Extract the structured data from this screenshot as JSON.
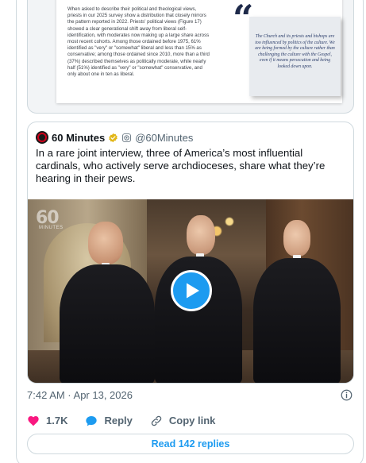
{
  "document_image": {
    "body_text": "When asked to describe their political and theological views, priests in our 2025 survey show a distribution that closely mirrors the pattern reported in 2022. Priests' political views (Figure 17) showed a clear generational shift away from liberal self-identification, with moderates now making up a large share across most recent cohorts. Among those ordained before 1975, 61% identified as \"very\" or \"somewhat\" liberal and less than 15% as conservative; among those ordained since 2010, more than a third (37%) described themselves as politically moderate, while nearly half (51%) identified as \"very\" or \"somewhat\" conservative, and only about one in ten as liberal.",
    "quote_mark": "“",
    "pull_quote": "The Church and its priests and bishops are too influenced by politics of the culture. We are being formed by the culture rather than challenging the culture with the Gospel, even if it means persecution and being looked down upon."
  },
  "quoted_tweet": {
    "author_name": "60 Minutes",
    "handle": "@60Minutes",
    "text": "In a rare joint interview, three of America’s most influential cardinals, who actively serve archdioceses, share what they’re hearing in their pews.",
    "video": {
      "logo_text": "60",
      "logo_subtext": "MINUTES",
      "play_icon": "play-icon"
    }
  },
  "tweet": {
    "timestamp": "7:42 AM · Apr 13, 2026",
    "likes": "1.7K",
    "reply_label": "Reply",
    "copy_link_label": "Copy link",
    "read_replies_label": "Read 142 replies"
  },
  "colors": {
    "accent": "#1d9bf0",
    "like": "#f91880",
    "muted": "#536471",
    "verified_gold": "#e2b719"
  }
}
